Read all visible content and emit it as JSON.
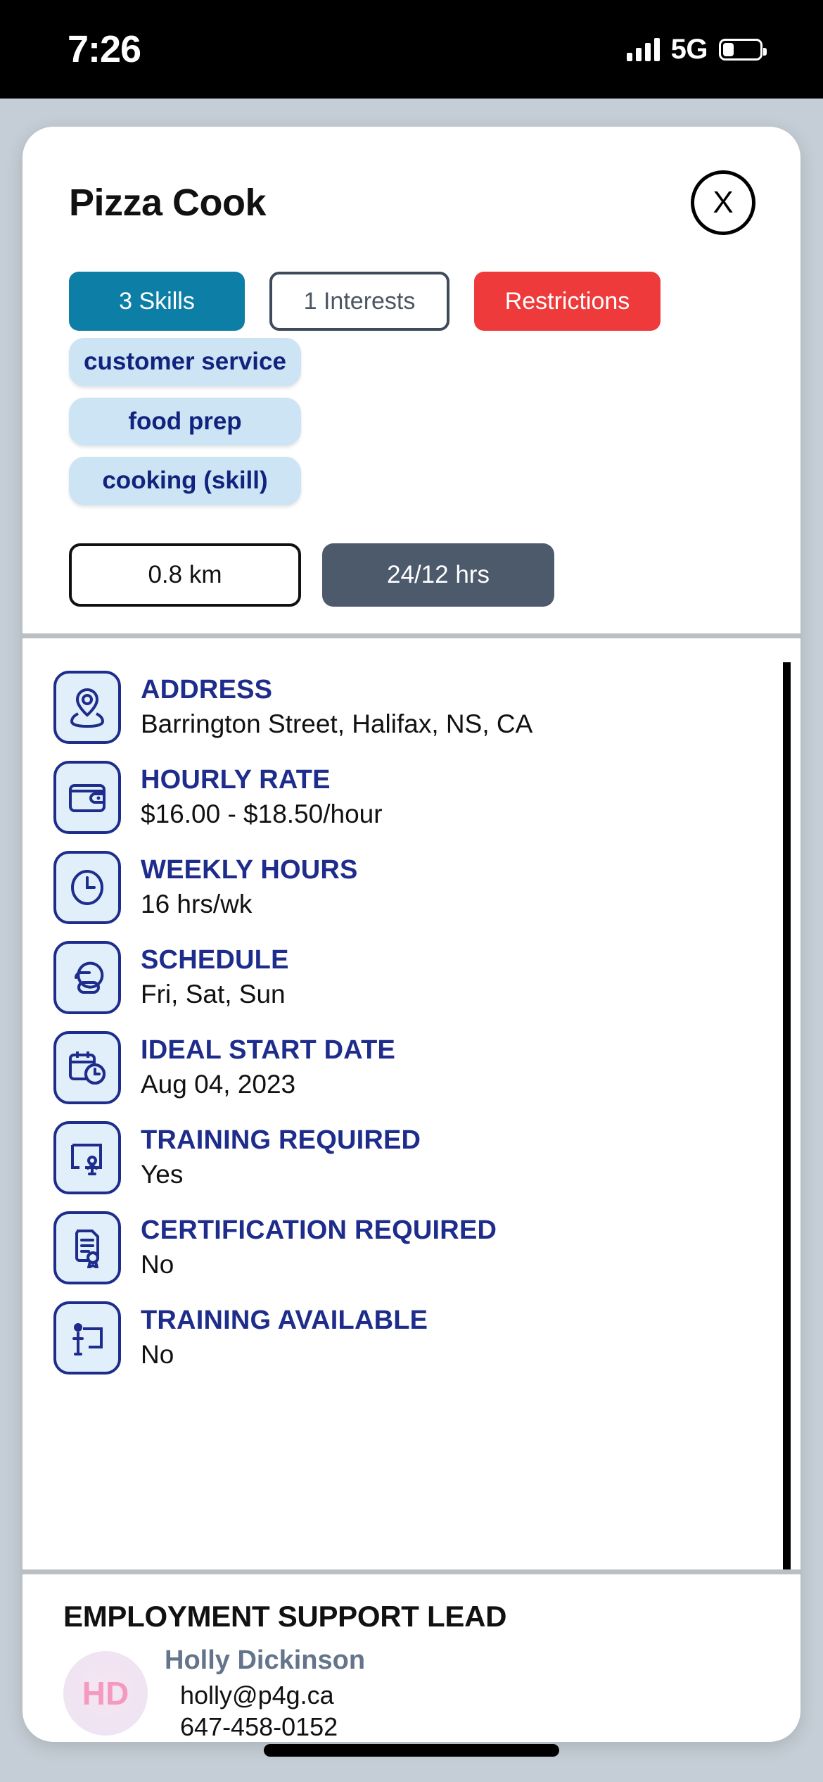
{
  "status_bar": {
    "time": "7:26",
    "network": "5G",
    "signal_icon": "signal-bars-icon",
    "battery_icon": "battery-icon"
  },
  "header": {
    "job_title": "Pizza Cook",
    "close_label": "X",
    "close_icon": "close-circle-icon"
  },
  "tabs": [
    {
      "label": "3 Skills",
      "state": "selected",
      "color": "#0d7ea6"
    },
    {
      "label": "1 Interests",
      "state": "default",
      "color": "#3f4b5b"
    },
    {
      "label": "Restrictions",
      "state": "alert",
      "color": "#ee3a3a"
    }
  ],
  "skill_chips": [
    "customer service",
    "food prep",
    "cooking (skill)"
  ],
  "meta_buttons": {
    "distance": "0.8 km",
    "hours": "24/12 hrs"
  },
  "details": [
    {
      "icon": "location-pin-icon",
      "label": "ADDRESS",
      "value": "Barrington Street, Halifax, NS, CA"
    },
    {
      "icon": "wallet-icon",
      "label": "HOURLY RATE",
      "value": "$16.00 - $18.50/hour"
    },
    {
      "icon": "clock-icon",
      "label": "WEEKLY HOURS",
      "value": "16 hrs/wk"
    },
    {
      "icon": "moon-clouds-icon",
      "label": "SCHEDULE",
      "value": "Fri, Sat, Sun"
    },
    {
      "icon": "calendar-clock-icon",
      "label": "IDEAL START DATE",
      "value": "Aug 04, 2023"
    },
    {
      "icon": "training-board-icon",
      "label": "TRAINING REQUIRED",
      "value": "Yes"
    },
    {
      "icon": "certificate-icon",
      "label": "CERTIFICATION REQUIRED",
      "value": "No"
    },
    {
      "icon": "presentation-icon",
      "label": "TRAINING AVAILABLE",
      "value": "No"
    }
  ],
  "footer": {
    "section_title": "EMPLOYMENT SUPPORT LEAD",
    "avatar_initials": "HD",
    "name": "Holly Dickinson",
    "email": "holly@p4g.ca",
    "phone": "647-458-0152"
  },
  "colors": {
    "accent_teal": "#0d7ea6",
    "alert_red": "#ee3a3a",
    "navy": "#1e2c8c",
    "chip_bg": "#cde4f5",
    "slate": "#4d5a6b",
    "backdrop": "#c5ced6"
  }
}
